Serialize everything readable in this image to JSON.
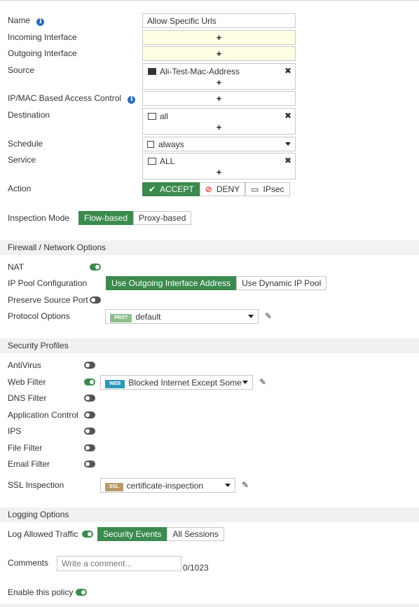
{
  "name": {
    "label": "Name",
    "value": "Allow Specific Urls"
  },
  "incoming_interface": {
    "label": "Incoming Interface",
    "add": "+"
  },
  "outgoing_interface": {
    "label": "Outgoing Interface",
    "add": "+"
  },
  "source": {
    "label": "Source",
    "entry": "Ali-Test-Mac-Address",
    "add": "+"
  },
  "ipmac": {
    "label": "IP/MAC Based Access Control",
    "add": "+"
  },
  "destination": {
    "label": "Destination",
    "entry": "all",
    "add": "+"
  },
  "schedule": {
    "label": "Schedule",
    "value": "always"
  },
  "service": {
    "label": "Service",
    "entry": "ALL",
    "add": "+"
  },
  "action": {
    "label": "Action",
    "options": [
      "ACCEPT",
      "DENY",
      "IPsec"
    ],
    "selected": "ACCEPT"
  },
  "inspection_mode": {
    "label": "Inspection Mode",
    "options": [
      "Flow-based",
      "Proxy-based"
    ],
    "selected": "Flow-based"
  },
  "firewall_section": {
    "title": "Firewall / Network Options",
    "nat": {
      "label": "NAT",
      "enabled": true
    },
    "ip_pool": {
      "label": "IP Pool Configuration",
      "options": [
        "Use Outgoing Interface Address",
        "Use Dynamic IP Pool"
      ],
      "selected": "Use Outgoing Interface Address"
    },
    "preserve_port": {
      "label": "Preserve Source Port",
      "enabled": false
    },
    "protocol_options": {
      "label": "Protocol Options",
      "tag": "PROT",
      "value": "default"
    }
  },
  "security_section": {
    "title": "Security Profiles",
    "antivirus": {
      "label": "AntiVirus",
      "enabled": false
    },
    "web_filter": {
      "label": "Web Filter",
      "enabled": true,
      "tag": "WEB",
      "value": "Blocked Internet Except Some"
    },
    "dns_filter": {
      "label": "DNS Filter",
      "enabled": false
    },
    "app_control": {
      "label": "Application Control",
      "enabled": false
    },
    "ips": {
      "label": "IPS",
      "enabled": false
    },
    "file_filter": {
      "label": "File Filter",
      "enabled": false
    },
    "email_filter": {
      "label": "Email Filter",
      "enabled": false
    },
    "ssl_inspection": {
      "label": "SSL Inspection",
      "tag": "SSL",
      "value": "certificate-inspection"
    }
  },
  "logging_section": {
    "title": "Logging Options",
    "log_allowed": {
      "label": "Log Allowed Traffic",
      "enabled": true,
      "options": [
        "Security Events",
        "All Sessions"
      ],
      "selected": "Security Events"
    }
  },
  "comments": {
    "label": "Comments",
    "placeholder": "Write a comment...",
    "counter": "0/1023"
  },
  "enable_policy": {
    "label": "Enable this policy",
    "enabled": true
  },
  "colors": {
    "accent": "#3b8a4e",
    "info": "#2a6ebb",
    "prot_tag": "#8fbf8f",
    "web_tag": "#2c9ab7",
    "ssl_tag": "#b89a6a"
  }
}
